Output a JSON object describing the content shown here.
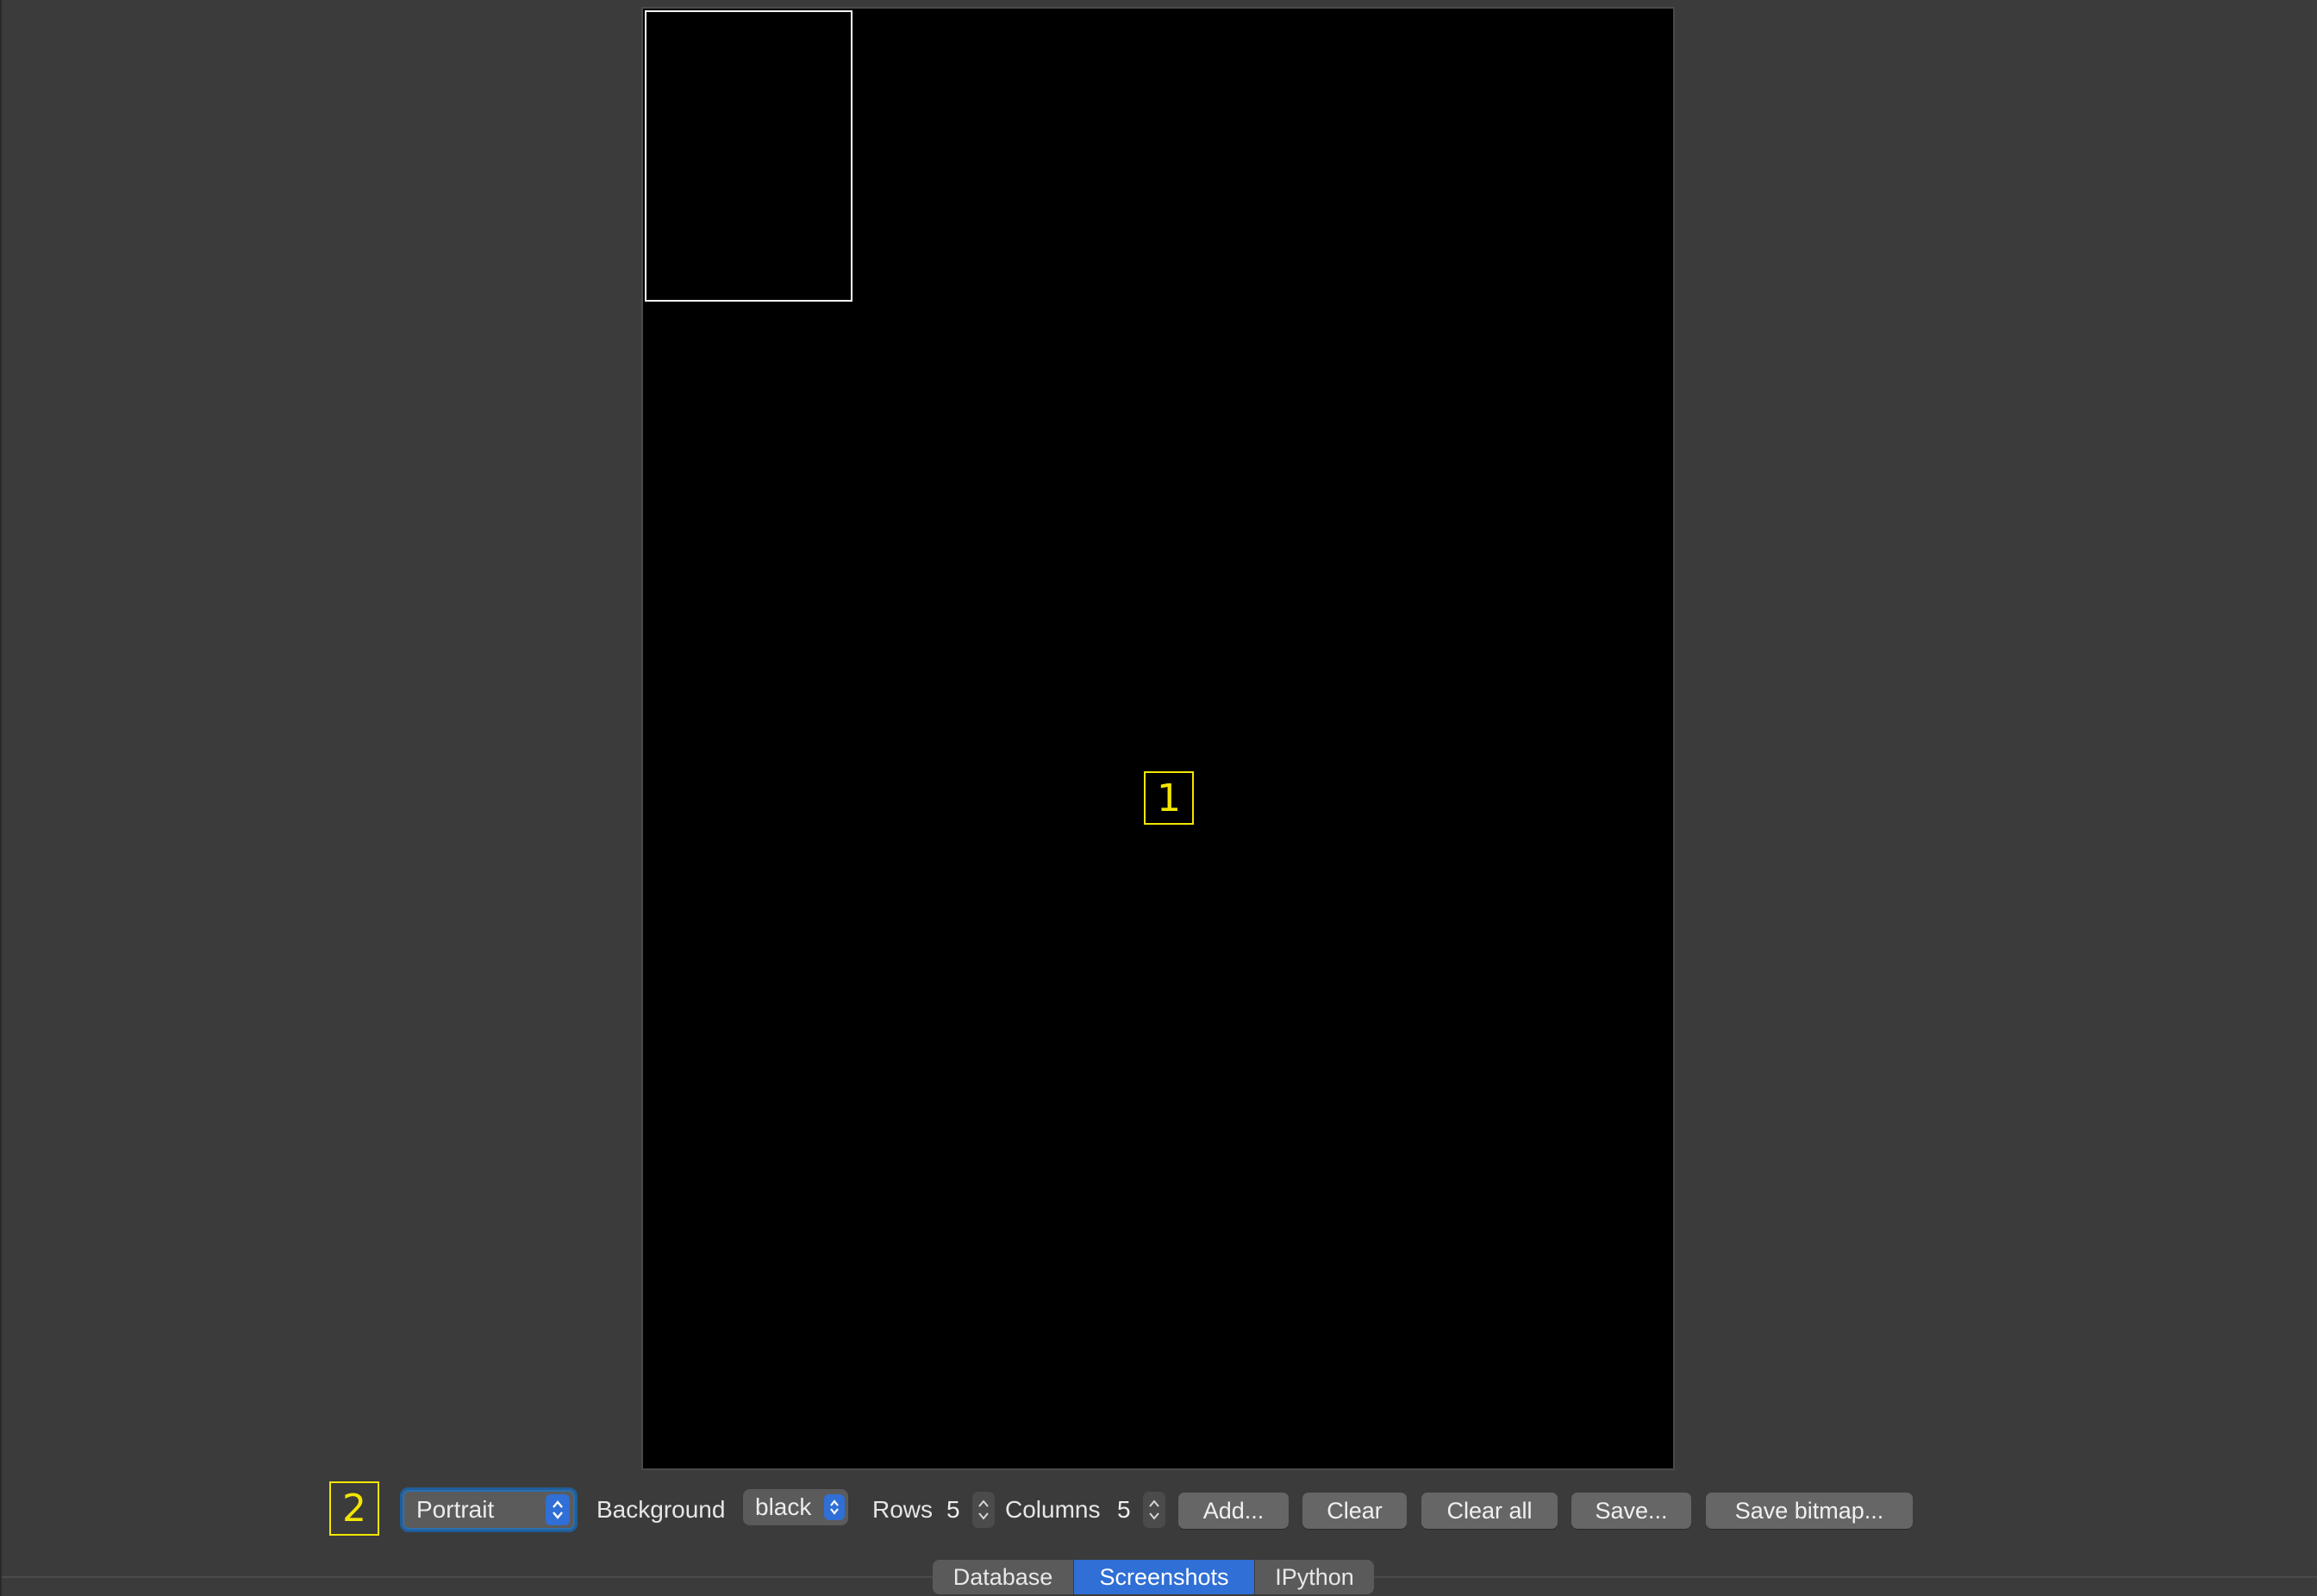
{
  "markers": {
    "canvas": "1",
    "toolbar": "2"
  },
  "toolbar": {
    "orientation_value": "Portrait",
    "background_label": "Background",
    "background_value": "black",
    "rows_label": "Rows",
    "rows_value": "5",
    "columns_label": "Columns",
    "columns_value": "5",
    "add_label": "Add...",
    "clear_label": "Clear",
    "clear_all_label": "Clear all",
    "save_label": "Save...",
    "save_bitmap_label": "Save bitmap..."
  },
  "tabs": [
    {
      "label": "Database",
      "active": false
    },
    {
      "label": "Screenshots",
      "active": true
    },
    {
      "label": "IPython",
      "active": false
    }
  ],
  "colors": {
    "window_bg": "#3b3b3b",
    "canvas_bg": "#000000",
    "marker": "#f2e600",
    "accent": "#2f6fd6"
  },
  "icons": {
    "select_chevron": "chevron-up-down-icon",
    "stepper": "stepper-arrows-icon"
  }
}
